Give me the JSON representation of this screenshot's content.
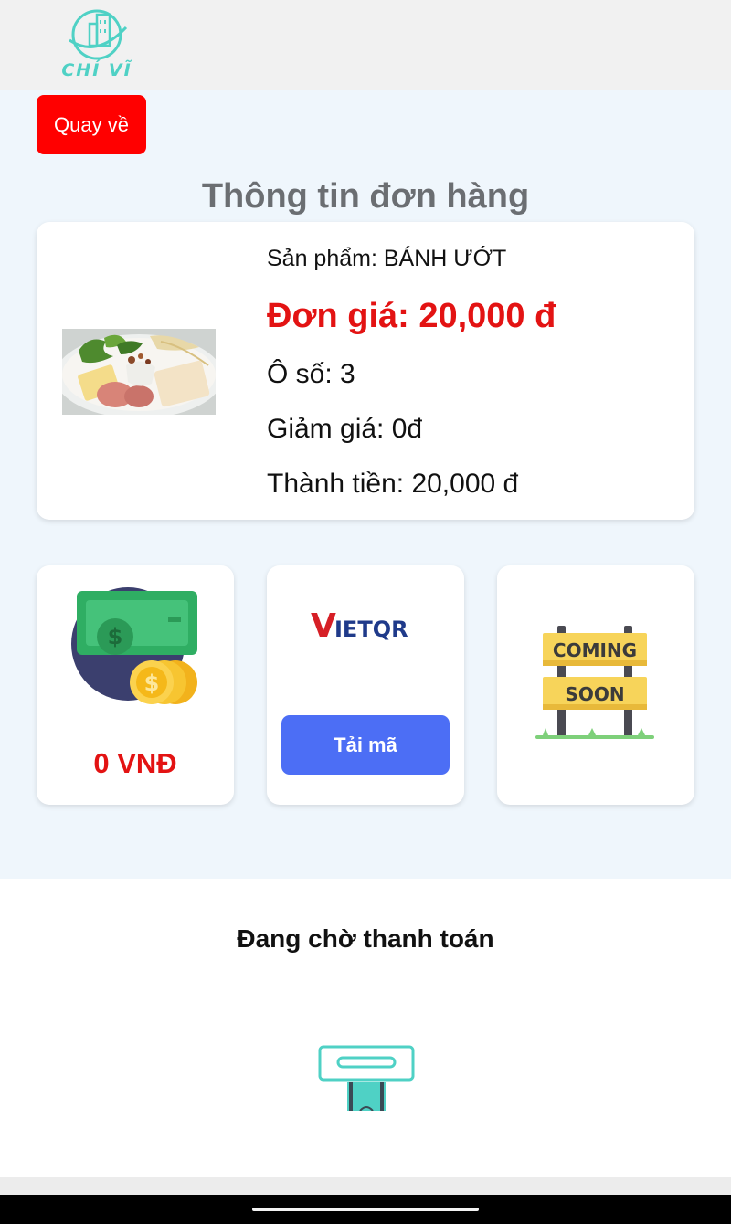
{
  "app": {
    "logo_text": "CHÍ VĨ"
  },
  "navigation": {
    "back_label": "Quay về"
  },
  "page": {
    "title": "Thông tin đơn hàng"
  },
  "order": {
    "product_label": "Sản phẩm: BÁNH ƯỚT",
    "unit_price_label": "Đơn giá: 20,000 đ",
    "slot_label": "Ô số: 3",
    "discount_label": "Giảm giá: 0đ",
    "total_label": "Thành tiền: 20,000 đ"
  },
  "payment_options": {
    "cash": {
      "amount": "0 VNĐ",
      "icon": "cash-coins-icon"
    },
    "vietqr": {
      "logo_text_v": "V",
      "logo_text_rest": "IETQR",
      "download_label": "Tải mã"
    },
    "coming_soon": {
      "sign_top": "COMING",
      "sign_bottom": "SOON"
    }
  },
  "status": {
    "waiting_text": "Đang chờ thanh toán",
    "icon": "payment-terminal-icon"
  },
  "colors": {
    "accent_red": "#ff0000",
    "price_red": "#e31313",
    "button_blue": "#4c6ef5",
    "logo_teal": "#4fd1c5",
    "background": "#eff6fc"
  }
}
